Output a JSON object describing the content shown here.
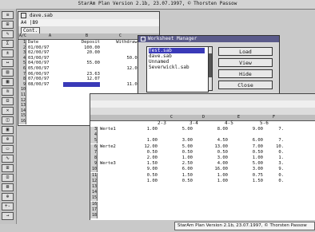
{
  "app": {
    "title": "StarAm Plan Version 2.1b, 23.07.1997, © Thorsten Passow",
    "status": "StarAm Plan Version 2.1b, 23.07.1997, © Thorsten Passow"
  },
  "toolbar": {
    "buttons": [
      "≡",
      "⊞",
      "✎",
      "Σ",
      "±",
      "↔",
      "▤",
      "▦",
      "≋",
      "⊟",
      "✕",
      "◫",
      "▣",
      "⊕",
      "▭",
      "∿",
      "⊞",
      "⊡",
      "⊠",
      "⊕",
      "+-",
      "→"
    ]
  },
  "sheet1": {
    "title": "dave.sab",
    "cell_ref": "A4 |B9",
    "sheet_name": "Cont.",
    "corner": "A/C",
    "columns": [
      "A",
      "B",
      "C"
    ],
    "headers": [
      "Date",
      "Deposit",
      "Withdrawl"
    ],
    "rows": [
      {
        "n": "1",
        "a": "Date",
        "b": "Deposit",
        "c": "Withdrawl"
      },
      {
        "n": "2",
        "a": "01/00/97",
        "b": "100.00",
        "c": ""
      },
      {
        "n": "3",
        "a": "02/00/97",
        "b": "20.00",
        "c": ""
      },
      {
        "n": "4",
        "a": "03/00/97",
        "b": "",
        "c": "50.00"
      },
      {
        "n": "5",
        "a": "04/00/97",
        "b": "55.00",
        "c": ""
      },
      {
        "n": "6",
        "a": "05/00/97",
        "b": "",
        "c": "12.00"
      },
      {
        "n": "7",
        "a": "06/00/97",
        "b": "23.63",
        "c": ""
      },
      {
        "n": "8",
        "a": "07/00/97",
        "b": "12.07",
        "c": ""
      },
      {
        "n": "9",
        "a": "08/00/97",
        "b": "",
        "c": "11.05"
      },
      {
        "n": "10",
        "a": "",
        "b": "",
        "c": ""
      },
      {
        "n": "11",
        "a": "",
        "b": "",
        "c": ""
      },
      {
        "n": "12",
        "a": "",
        "b": "",
        "c": ""
      },
      {
        "n": "13",
        "a": "",
        "b": "",
        "c": ""
      },
      {
        "n": "14",
        "a": "",
        "b": "",
        "c": ""
      },
      {
        "n": "15",
        "a": "",
        "b": "",
        "c": ""
      },
      {
        "n": "16",
        "a": "",
        "b": "",
        "c": ""
      }
    ]
  },
  "worksheet_manager": {
    "title": "Worksheet Manager",
    "items": [
      "Test.sab",
      "dave.sab",
      "Unnamed",
      "Severwickl.sab"
    ],
    "selected_index": 0,
    "buttons": {
      "load": "Load",
      "view": "View",
      "hide": "Hide",
      "close": "Close"
    }
  },
  "sheet2": {
    "columns": [
      "C",
      "D",
      "E",
      "F"
    ],
    "header_labels": [
      "2-3",
      "3-4",
      "4-5",
      "5-6"
    ],
    "rows": [
      {
        "n": "3",
        "label": "Werte1",
        "v": [
          "1.00",
          "5.00",
          "8.00",
          "9.00",
          "7."
        ]
      },
      {
        "n": "4",
        "label": "",
        "v": [
          "",
          "",
          "",
          "",
          ""
        ]
      },
      {
        "n": "5",
        "label": "",
        "v": [
          "1.00",
          "3.00",
          "4.50",
          "6.00",
          "7."
        ]
      },
      {
        "n": "6",
        "label": "Werte2",
        "v": [
          "12.00",
          "5.00",
          "13.00",
          "7.00",
          "10."
        ]
      },
      {
        "n": "7",
        "label": "",
        "v": [
          "0.50",
          "0.50",
          "0.50",
          "0.50",
          "0."
        ]
      },
      {
        "n": "8",
        "label": "",
        "v": [
          "2.00",
          "1.00",
          "3.00",
          "1.00",
          "1."
        ]
      },
      {
        "n": "9",
        "label": "Werte3",
        "v": [
          "1.50",
          "2.50",
          "4.00",
          "5.00",
          "3."
        ]
      },
      {
        "n": "10",
        "label": "",
        "v": [
          "9.00",
          "6.00",
          "16.00",
          "3.00",
          "9."
        ]
      },
      {
        "n": "11",
        "label": "",
        "v": [
          "0.50",
          "1.50",
          "1.00",
          "0.75",
          "0."
        ]
      },
      {
        "n": "12",
        "label": "",
        "v": [
          "1.00",
          "0.50",
          "1.00",
          "1.50",
          "0."
        ]
      },
      {
        "n": "13",
        "label": "",
        "v": [
          "",
          "",
          "",
          "",
          ""
        ]
      },
      {
        "n": "14",
        "label": "",
        "v": [
          "",
          "",
          "",
          "",
          ""
        ]
      },
      {
        "n": "15",
        "label": "",
        "v": [
          "",
          "",
          "",
          "",
          ""
        ]
      },
      {
        "n": "16",
        "label": "",
        "v": [
          "",
          "",
          "",
          "",
          ""
        ]
      },
      {
        "n": "17",
        "label": "",
        "v": [
          "",
          "",
          "",
          "",
          ""
        ]
      },
      {
        "n": "18",
        "label": "",
        "v": [
          "",
          "",
          "",
          "",
          ""
        ]
      }
    ]
  },
  "colors": {
    "selection": "#3a3ab8",
    "dialog_title": "#5a5a8a"
  }
}
